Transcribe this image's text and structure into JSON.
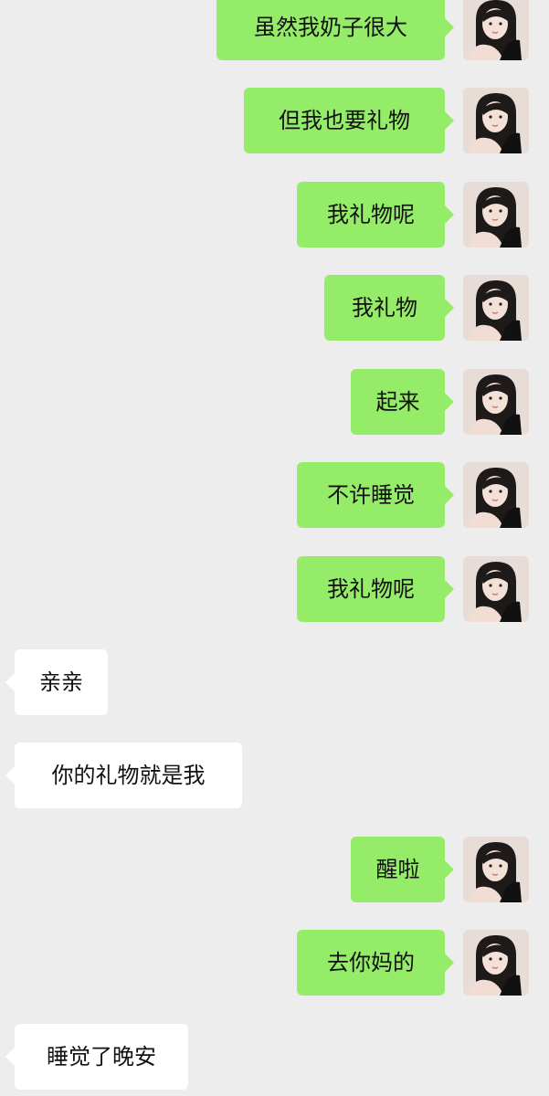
{
  "conversation": {
    "messages": [
      {
        "side": "out",
        "text": "虽然我奶子很大"
      },
      {
        "side": "out",
        "text": "但我也要礼物"
      },
      {
        "side": "out",
        "text": "我礼物呢"
      },
      {
        "side": "out",
        "text": "我礼物"
      },
      {
        "side": "out",
        "text": "起来"
      },
      {
        "side": "out",
        "text": "不许睡觉"
      },
      {
        "side": "out",
        "text": "我礼物呢"
      },
      {
        "side": "in",
        "text": "亲亲"
      },
      {
        "side": "in",
        "text": "你的礼物就是我"
      },
      {
        "side": "out",
        "text": "醒啦"
      },
      {
        "side": "out",
        "text": "去你妈的"
      },
      {
        "side": "in",
        "text": "睡觉了晚安"
      }
    ]
  },
  "colors": {
    "background": "#ededed",
    "outgoing_bubble": "#95ec69",
    "incoming_bubble": "#ffffff",
    "text": "#111111"
  },
  "icons": {
    "avatar": "user-avatar-photo"
  }
}
